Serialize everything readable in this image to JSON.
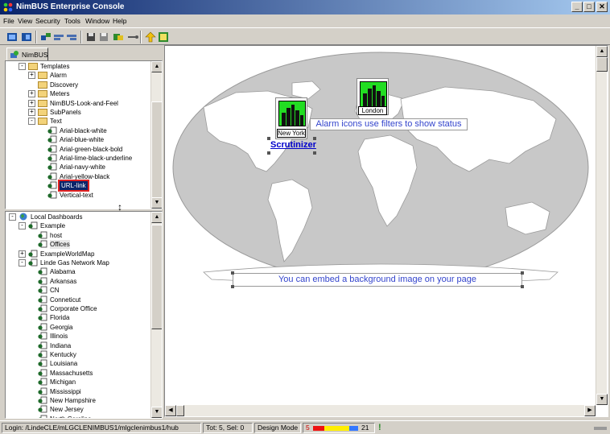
{
  "window": {
    "title": "NimBUS Enterprise Console",
    "controls": {
      "minimize": "_",
      "maximize": "□",
      "close": "✕"
    }
  },
  "menu": [
    "File",
    "View",
    "Security",
    "Tools",
    "Window",
    "Help"
  ],
  "toolbar": {
    "icons": [
      "layout-icon",
      "layout-alt-icon",
      "connect-icon",
      "align-left-icon",
      "align-right-icon",
      "save-icon",
      "save-all-icon",
      "refresh-icon",
      "link-icon",
      "up-arrow-icon",
      "grid-icon"
    ]
  },
  "left_pane": {
    "tab_label": "NimBUS",
    "templates_tree": [
      {
        "label": "Templates",
        "level": 1,
        "kind": "folder",
        "expander": "-"
      },
      {
        "label": "Alarm",
        "level": 2,
        "kind": "folder",
        "expander": "+"
      },
      {
        "label": "Discovery",
        "level": 2,
        "kind": "folder",
        "expander": ""
      },
      {
        "label": "Meters",
        "level": 2,
        "kind": "folder",
        "expander": "+"
      },
      {
        "label": "NimBUS-Look-and-Feel",
        "level": 2,
        "kind": "folder",
        "expander": "+"
      },
      {
        "label": "SubPanels",
        "level": 2,
        "kind": "folder",
        "expander": "+"
      },
      {
        "label": "Text",
        "level": 2,
        "kind": "folder",
        "expander": "-"
      },
      {
        "label": "Arial-black-white",
        "level": 3,
        "kind": "doc",
        "expander": ""
      },
      {
        "label": "Arial-blue-white",
        "level": 3,
        "kind": "doc",
        "expander": ""
      },
      {
        "label": "Arial-green-black-bold",
        "level": 3,
        "kind": "doc",
        "expander": ""
      },
      {
        "label": "Arial-lime-black-underline",
        "level": 3,
        "kind": "doc",
        "expander": ""
      },
      {
        "label": "Arial-navy-white",
        "level": 3,
        "kind": "doc",
        "expander": ""
      },
      {
        "label": "Arial-yellow-black",
        "level": 3,
        "kind": "doc",
        "expander": ""
      },
      {
        "label": "URL-link",
        "level": 3,
        "kind": "doc",
        "expander": "",
        "selected": true
      },
      {
        "label": "Vertical-text",
        "level": 3,
        "kind": "doc",
        "expander": ""
      }
    ],
    "dashboards_tree": [
      {
        "label": "Local Dashboards",
        "level": 0,
        "kind": "globe",
        "expander": "-"
      },
      {
        "label": "Example",
        "level": 1,
        "kind": "doc",
        "expander": "-"
      },
      {
        "label": "host",
        "level": 2,
        "kind": "doc",
        "expander": ""
      },
      {
        "label": "Offices",
        "level": 2,
        "kind": "doc",
        "expander": "",
        "highlight": true
      },
      {
        "label": "ExampleWorldMap",
        "level": 1,
        "kind": "doc",
        "expander": "+"
      },
      {
        "label": "Linde Gas Network Map",
        "level": 1,
        "kind": "doc",
        "expander": "-"
      },
      {
        "label": "Alabama",
        "level": 2,
        "kind": "doc",
        "expander": ""
      },
      {
        "label": "Arkansas",
        "level": 2,
        "kind": "doc",
        "expander": ""
      },
      {
        "label": "CN",
        "level": 2,
        "kind": "doc",
        "expander": ""
      },
      {
        "label": "Conneticut",
        "level": 2,
        "kind": "doc",
        "expander": ""
      },
      {
        "label": "Corporate Office",
        "level": 2,
        "kind": "doc",
        "expander": ""
      },
      {
        "label": "Florida",
        "level": 2,
        "kind": "doc",
        "expander": ""
      },
      {
        "label": "Georgia",
        "level": 2,
        "kind": "doc",
        "expander": ""
      },
      {
        "label": "Illinois",
        "level": 2,
        "kind": "doc",
        "expander": ""
      },
      {
        "label": "Indiana",
        "level": 2,
        "kind": "doc",
        "expander": ""
      },
      {
        "label": "Kentucky",
        "level": 2,
        "kind": "doc",
        "expander": ""
      },
      {
        "label": "Louisiana",
        "level": 2,
        "kind": "doc",
        "expander": ""
      },
      {
        "label": "Massachusetts",
        "level": 2,
        "kind": "doc",
        "expander": ""
      },
      {
        "label": "Michigan",
        "level": 2,
        "kind": "doc",
        "expander": ""
      },
      {
        "label": "Mississippi",
        "level": 2,
        "kind": "doc",
        "expander": ""
      },
      {
        "label": "New Hampshire",
        "level": 2,
        "kind": "doc",
        "expander": ""
      },
      {
        "label": "New Jersey",
        "level": 2,
        "kind": "doc",
        "expander": ""
      },
      {
        "label": "North Carolina",
        "level": 2,
        "kind": "doc",
        "expander": ""
      }
    ]
  },
  "canvas": {
    "cities": [
      {
        "label": "New York",
        "status_color": "#22dd22"
      },
      {
        "label": "London",
        "status_color": "#22dd22"
      }
    ],
    "alarm_note": "Alarm icons use filters to show status",
    "link_text": "Scrutinizer",
    "background_note": "You can embed a background image on your page",
    "map_colors": {
      "ocean": "#c8c8c8",
      "land": "#ffffff"
    }
  },
  "statusbar": {
    "login": "Login: /LindeCLE/mLGCLENIMBUS1/mlgclenimbus1/hub",
    "tot_sel": "Tot: 5,  Sel: 0",
    "mode": "Design Mode",
    "alarm_low": "5",
    "alarm_high": "21",
    "alarm_colors": [
      "#ee1111",
      "#ffee00",
      "#3377ff"
    ]
  }
}
